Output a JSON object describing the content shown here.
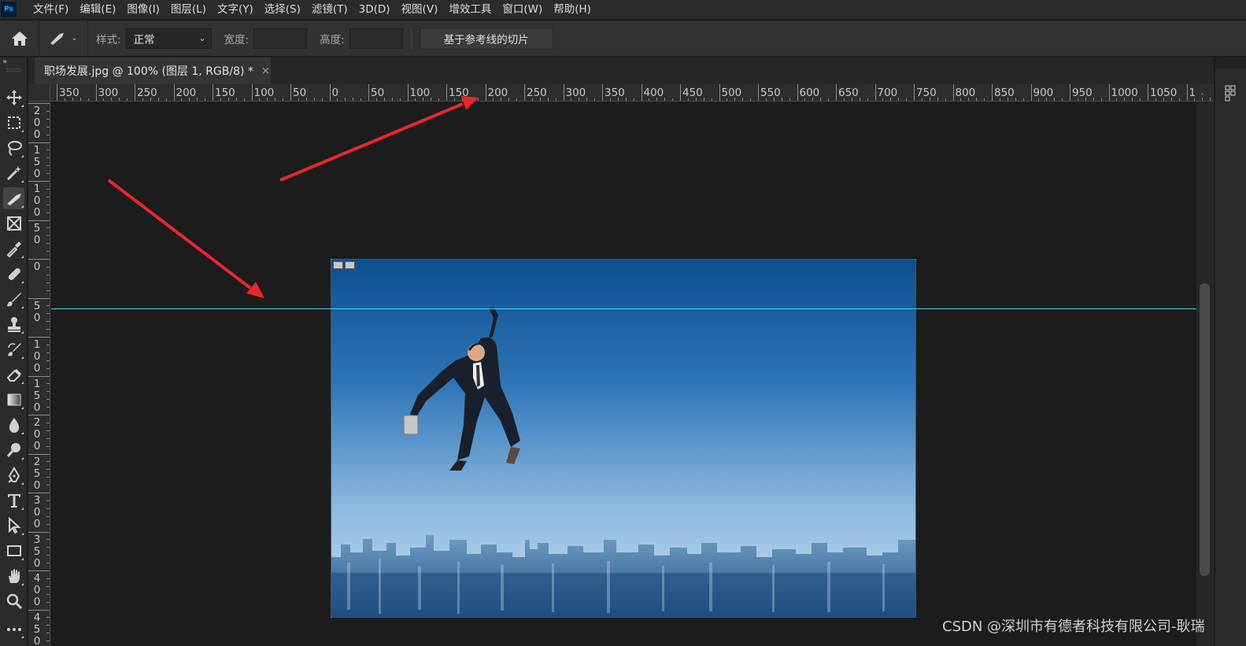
{
  "app": {
    "logo": "Ps"
  },
  "menu": [
    "文件(F)",
    "编辑(E)",
    "图像(I)",
    "图层(L)",
    "文字(Y)",
    "选择(S)",
    "滤镜(T)",
    "3D(D)",
    "视图(V)",
    "增效工具",
    "窗口(W)",
    "帮助(H)"
  ],
  "options": {
    "style_label": "样式:",
    "style_value": "正常",
    "width_label": "宽度:",
    "height_label": "高度:",
    "slices_button": "基于参考线的切片"
  },
  "document": {
    "tab_title": "职场发展.jpg @ 100% (图层 1, RGB/8) *",
    "close": "×"
  },
  "ruler": {
    "h_labels": [
      "350",
      "300",
      "250",
      "200",
      "150",
      "100",
      "50",
      "0",
      "50",
      "100",
      "150",
      "200",
      "250",
      "300",
      "350",
      "400",
      "450",
      "500",
      "550",
      "600",
      "650",
      "700",
      "750",
      "800",
      "850",
      "900",
      "950",
      "1000",
      "1050",
      "1"
    ],
    "v_labels": [
      "200",
      "150",
      "100",
      "50",
      "0",
      "50",
      "100",
      "150",
      "200",
      "250",
      "300",
      "350",
      "400",
      "450"
    ]
  },
  "tools": [
    "move-tool",
    "marquee-tool",
    "lasso-tool",
    "magic-wand-tool",
    "slice-tool",
    "frame-tool",
    "eyedropper-tool",
    "healing-brush-tool",
    "brush-tool",
    "clone-stamp-tool",
    "history-brush-tool",
    "eraser-tool",
    "gradient-tool",
    "blur-tool",
    "dodge-tool",
    "pen-tool",
    "type-tool",
    "path-selection-tool",
    "rectangle-tool",
    "hand-tool",
    "zoom-tool",
    "more-tools"
  ],
  "watermark": "CSDN @深圳市有德者科技有限公司-耿瑞",
  "colors": {
    "guide": "#3ce0f0",
    "arrow": "#e8262a",
    "sky_top": "#0b4f8f",
    "sky_bottom": "#bcd7ea"
  }
}
